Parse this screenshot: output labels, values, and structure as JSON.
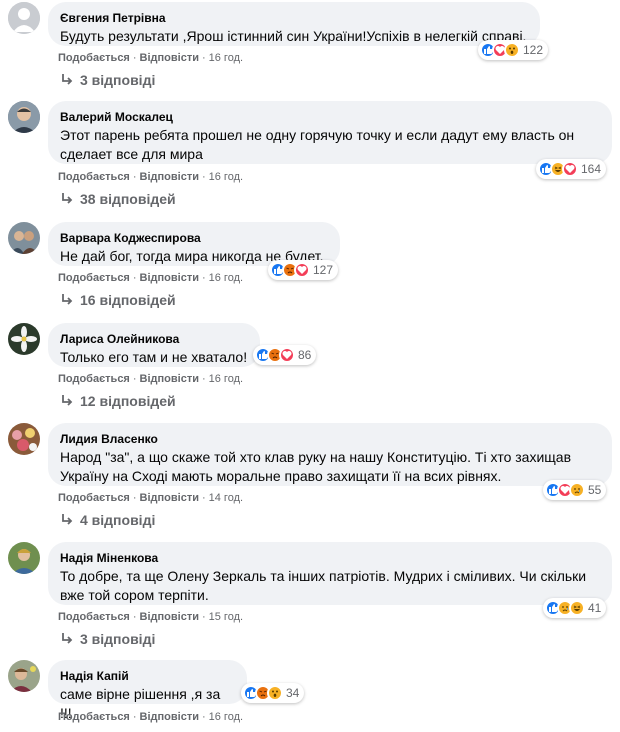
{
  "labels": {
    "like": "Подобається",
    "reply": "Відповісти"
  },
  "comments": [
    {
      "author": "Євгения Петрівна",
      "text": "Будуть результати ,Ярош істинний син України!Успіхів в нелегкій справі.",
      "reactions": [
        "like",
        "love",
        "wow"
      ],
      "count": "122",
      "time": "16 год.",
      "replies": "3 відповіді"
    },
    {
      "author": "Валерий Москалец",
      "text": "Этот парень ребята прошел не одну горячую точку и если дадут ему власть он сделает все для мира",
      "reactions": [
        "like",
        "haha",
        "love"
      ],
      "count": "164",
      "time": "16 год.",
      "replies": "38 відповідей"
    },
    {
      "author": "Варвара Коджеспирова",
      "text": "Не дай бог, тогда мира никогда не будет.",
      "reactions": [
        "like",
        "angry",
        "love"
      ],
      "count": "127",
      "time": "16 год.",
      "replies": "16 відповідей"
    },
    {
      "author": "Лариса Олейникова",
      "text": "Только его там и не хватало!",
      "reactions": [
        "like",
        "angry",
        "love"
      ],
      "count": "86",
      "time": "16 год.",
      "replies": "12 відповідей"
    },
    {
      "author": "Лидия Власенко",
      "text": "Народ \"за\", а що скаже той хто клав руку на нашу Конституцію. Ті хто захищав Україну на Сході мають моральне право захищати її на всих рівнях.",
      "reactions": [
        "like",
        "love",
        "sad"
      ],
      "count": "55",
      "time": "14 год.",
      "replies": "4 відповіді"
    },
    {
      "author": "Надія Міненкова",
      "text": "То добре, та ще Олену Зеркаль та інших патріотів. Мудрих і сміливих. Чи скільки вже той сором терпіти.",
      "reactions": [
        "like",
        "sad",
        "haha"
      ],
      "count": "41",
      "time": "15 год.",
      "replies": "3 відповіді"
    },
    {
      "author": "Надія Капій",
      "text": "саме вірне рішення ,я за !!!",
      "reactions": [
        "like",
        "angry",
        "wow"
      ],
      "count": "34",
      "time": "16 год.",
      "replies": ""
    }
  ],
  "colors": {
    "like": "#1877f2",
    "love": "#f33e58",
    "haha": "#f7b125",
    "angry": "#e9710f",
    "bubble": "#f0f2f5",
    "meta": "#65676b"
  }
}
